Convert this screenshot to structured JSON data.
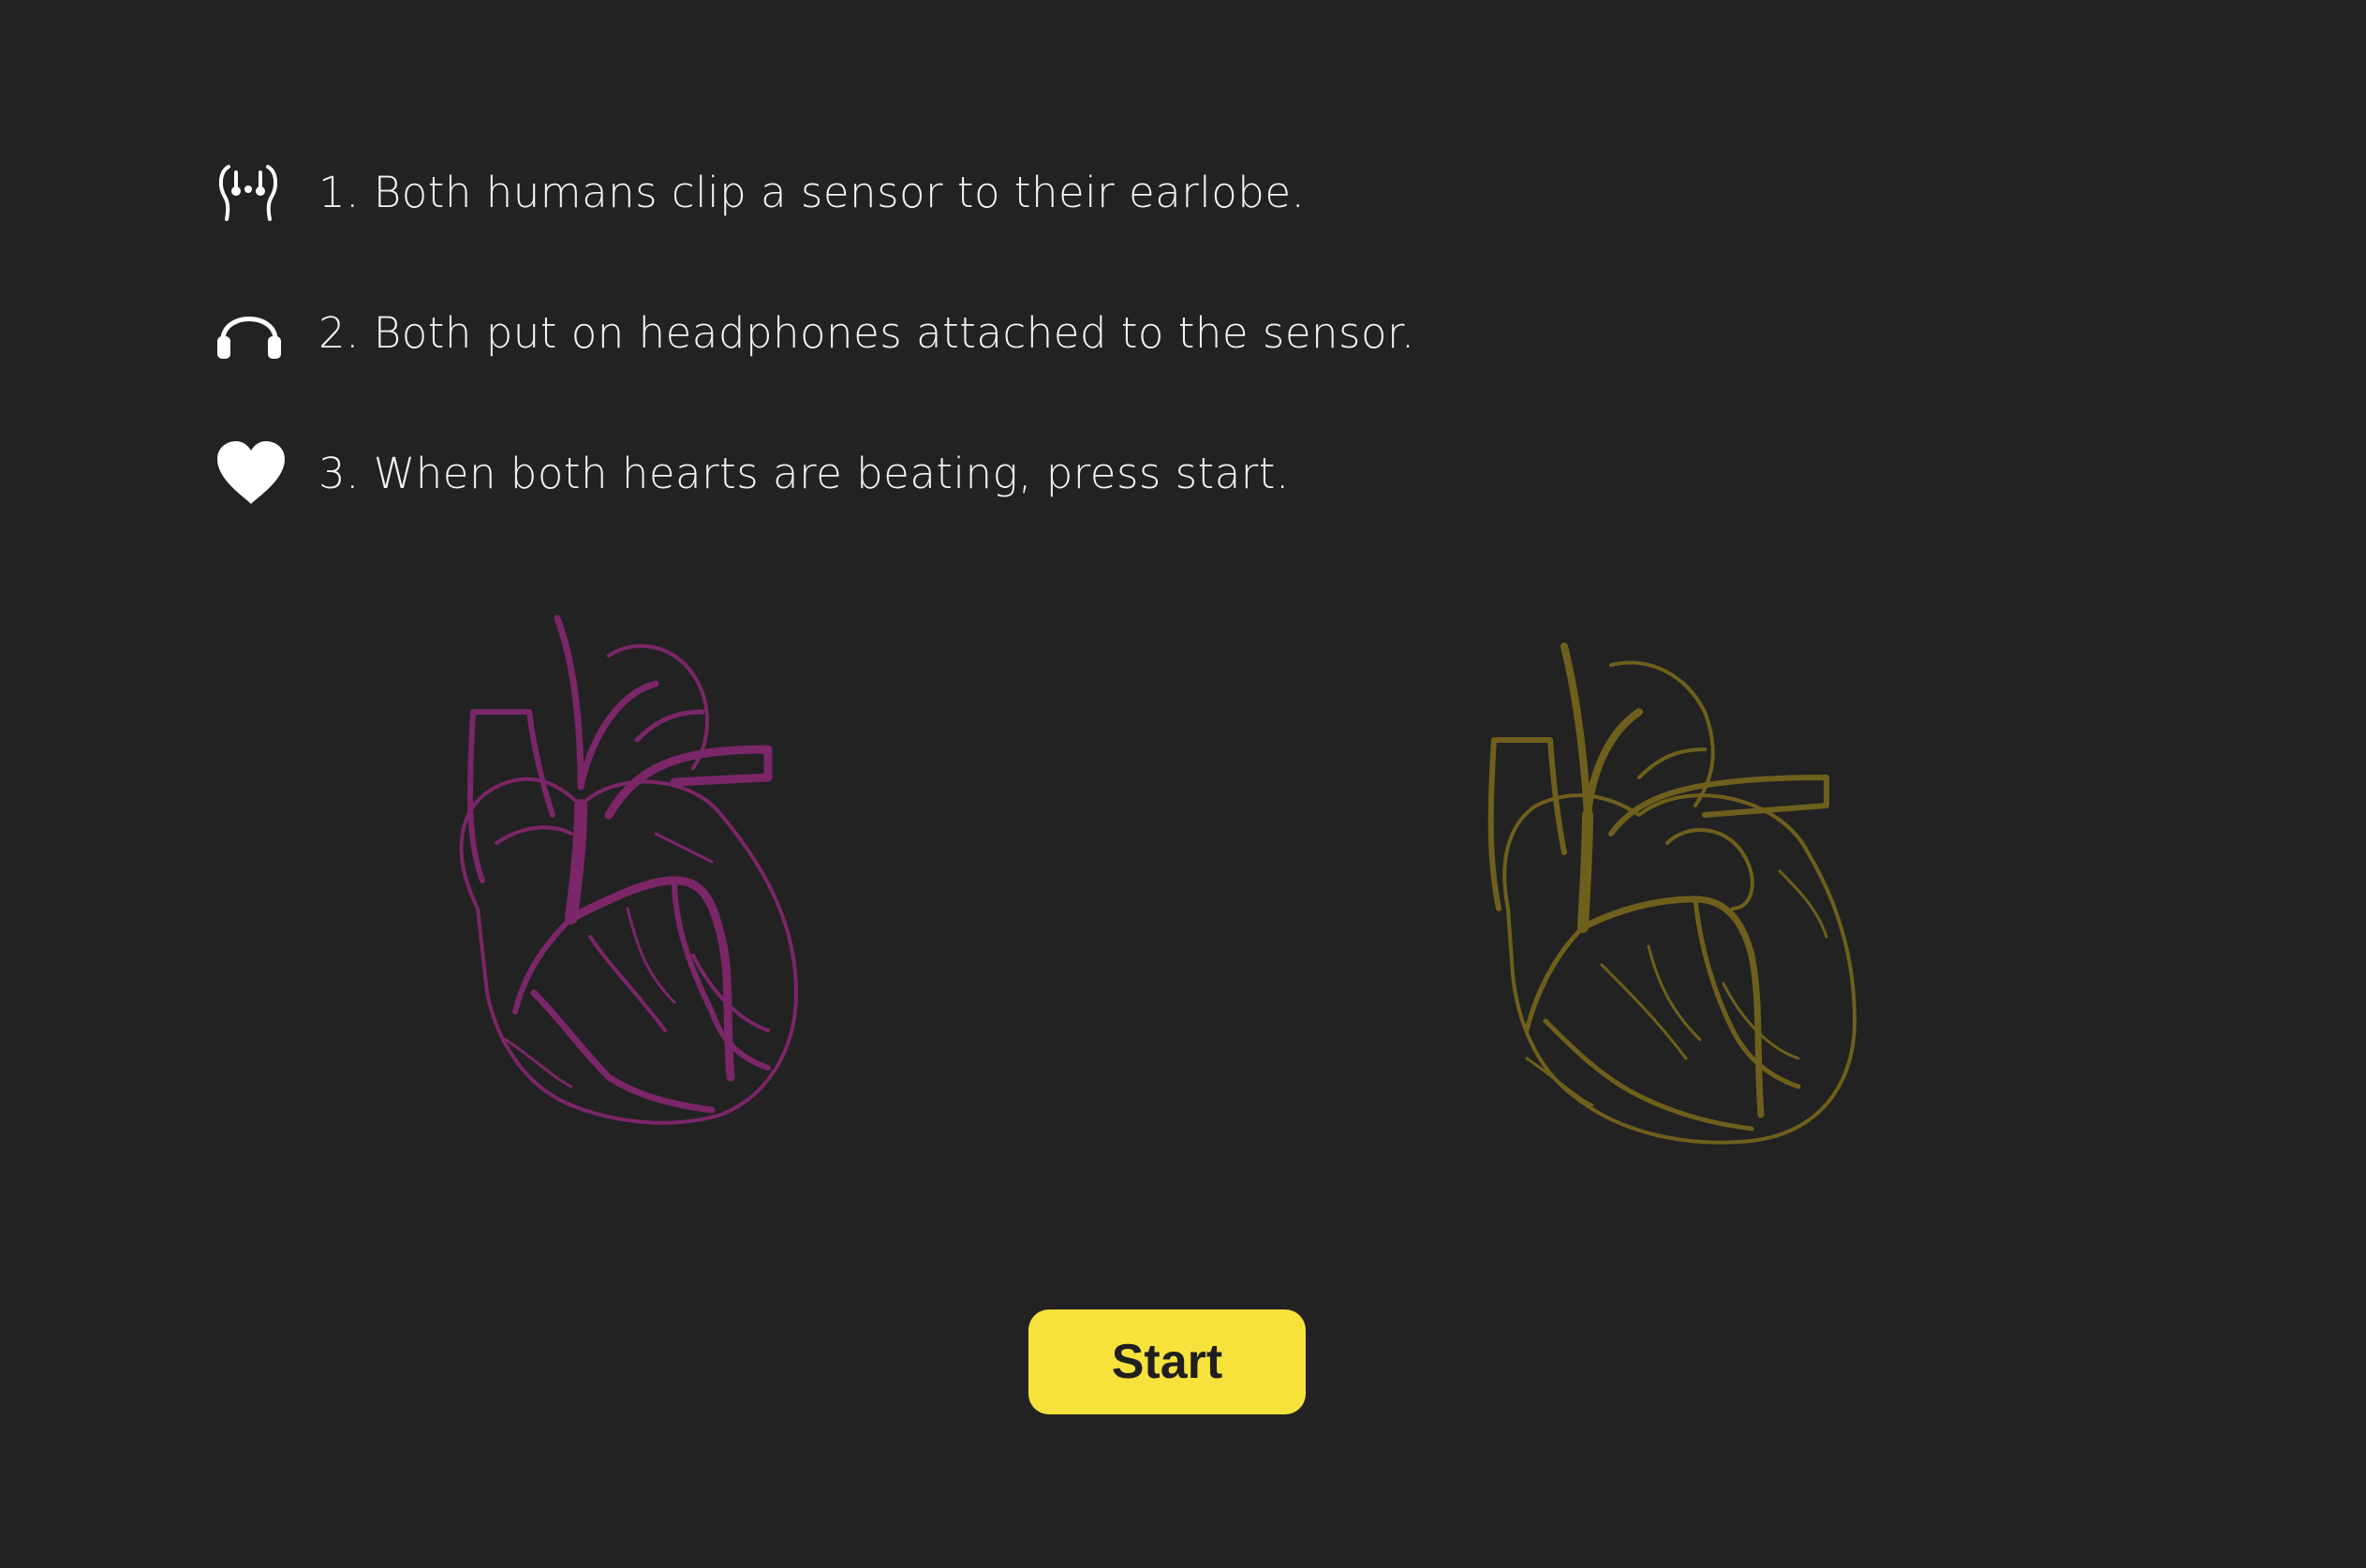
{
  "instructions": {
    "steps": [
      {
        "icon": "earlobe-sensor-icon",
        "text": "1. Both humans clip a sensor to their earlobe."
      },
      {
        "icon": "headphones-icon",
        "text": "2. Both put on headphones attached to the sensor."
      },
      {
        "icon": "heart-icon",
        "text": "3. When both hearts are beating, press start."
      }
    ]
  },
  "hearts": {
    "left": {
      "icon": "anatomical-heart-left",
      "color": "#7b2668"
    },
    "right": {
      "icon": "anatomical-heart-right",
      "color": "#6f5f1c"
    }
  },
  "start_button": {
    "label": "Start",
    "color": "#f6e23b"
  }
}
